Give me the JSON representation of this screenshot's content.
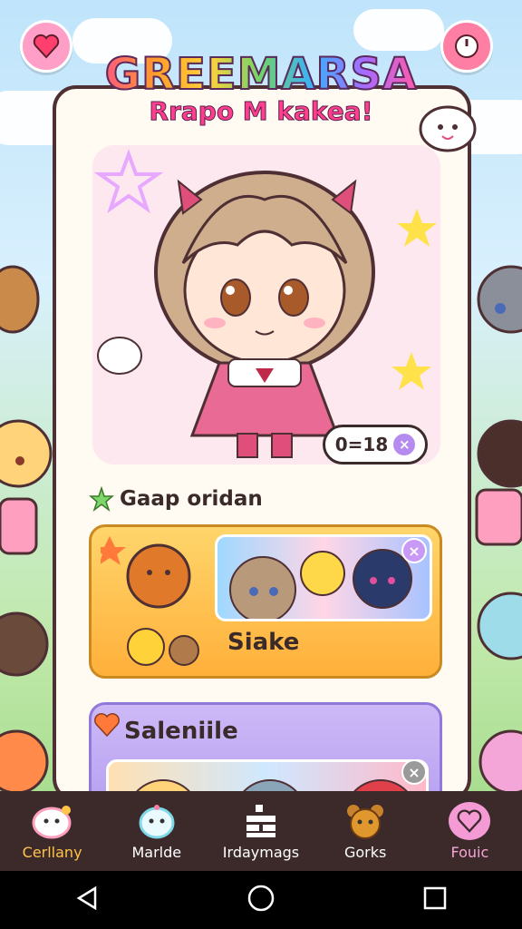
{
  "header": {
    "title": "GREEMARSA",
    "subtitle": "Rrapo M kakea!"
  },
  "hero": {
    "stat_value": "0=18",
    "stat_close": "×"
  },
  "section": {
    "title": "Gaap oridan"
  },
  "cards": [
    {
      "label": "Siake",
      "close": "×",
      "color": "#ffc24a"
    },
    {
      "label": "Saleniile",
      "close": "×",
      "color": "#bda6f3"
    }
  ],
  "nav": {
    "items": [
      {
        "label": "Cerllany",
        "icon": "ghost-mascot-icon",
        "active": true
      },
      {
        "label": "Marlde",
        "icon": "ghost-face-icon",
        "active": false
      },
      {
        "label": "Irdaymags",
        "icon": "grid-list-icon",
        "active": false
      },
      {
        "label": "Gorks",
        "icon": "bear-icon",
        "active": false
      },
      {
        "label": "Fouic",
        "icon": "heart-bubble-icon",
        "active": false
      }
    ]
  },
  "system_nav": [
    "back-icon",
    "home-icon",
    "recents-icon"
  ],
  "colors": {
    "panel_bg": "#fffaf2",
    "outline": "#4e2f33",
    "nav_bg": "#3c2a2a",
    "accent_yellow": "#ffc44a",
    "accent_pink": "#ff7fa4",
    "accent_purple": "#b58bf0"
  }
}
